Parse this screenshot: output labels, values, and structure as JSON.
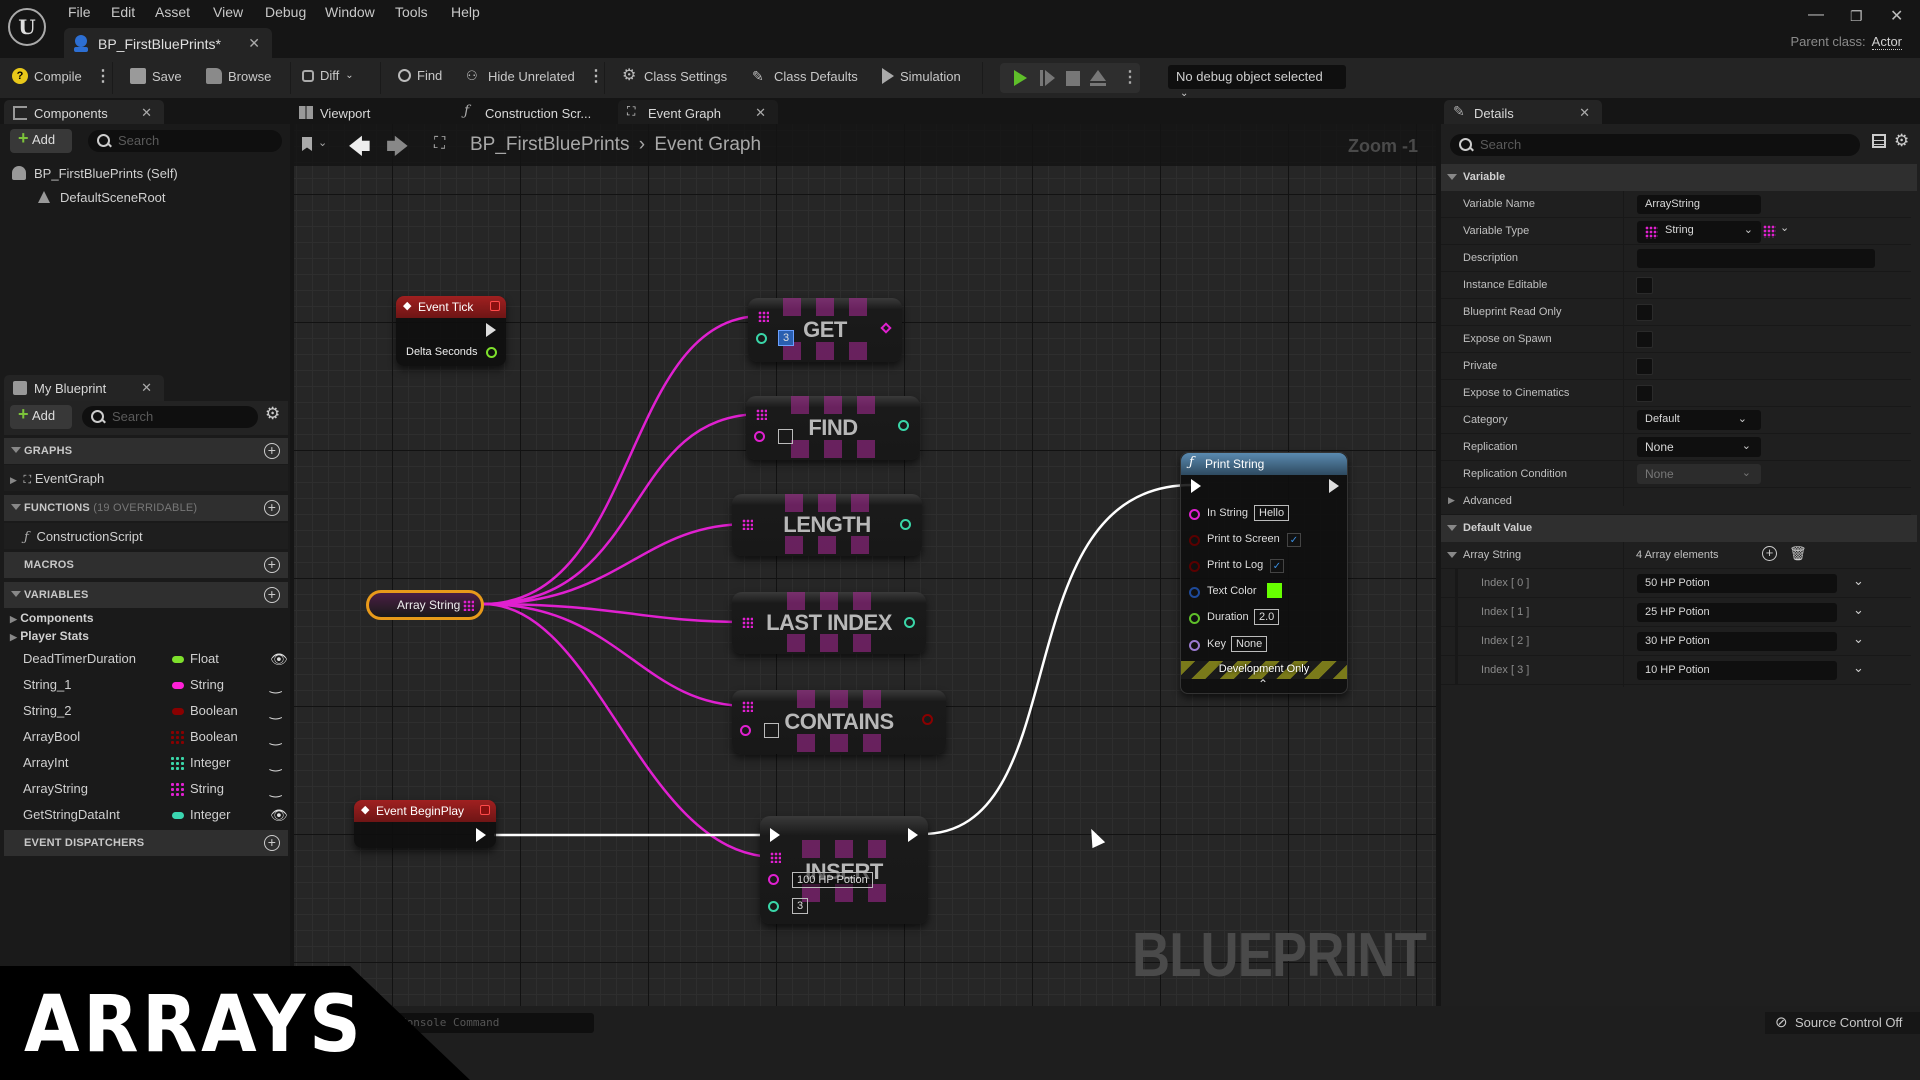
{
  "app": {
    "menu": [
      "File",
      "Edit",
      "Asset",
      "View",
      "Debug",
      "Window",
      "Tools",
      "Help"
    ],
    "document_tab": "BP_FirstBluePrints*",
    "parent_class_label": "Parent class:",
    "parent_class_value": "Actor"
  },
  "toolbar": {
    "compile": "Compile",
    "save": "Save",
    "browse": "Browse",
    "diff": "Diff",
    "find": "Find",
    "hide_unrelated": "Hide Unrelated",
    "class_settings": "Class Settings",
    "class_defaults": "Class Defaults",
    "simulation": "Simulation",
    "debug_object": "No debug object selected"
  },
  "components_panel": {
    "title": "Components",
    "add": "Add",
    "search_placeholder": "Search",
    "tree": [
      "BP_FirstBluePrints (Self)",
      "DefaultSceneRoot"
    ]
  },
  "my_blueprint": {
    "title": "My Blueprint",
    "add": "Add",
    "search_placeholder": "Search",
    "sections": {
      "graphs": "GRAPHS",
      "functions": "FUNCTIONS",
      "functions_sub": "(19 OVERRIDABLE)",
      "macros": "MACROS",
      "variables": "VARIABLES",
      "event_dispatchers": "EVENT DISPATCHERS"
    },
    "graph_items": [
      "EventGraph"
    ],
    "function_items": [
      "ConstructionScript"
    ],
    "variable_categories": [
      "Components",
      "Player Stats"
    ],
    "variables": [
      {
        "name": "DeadTimerDuration",
        "type": "Float",
        "color": "#7ee02c",
        "array": false,
        "visible": true
      },
      {
        "name": "String_1",
        "type": "String",
        "color": "#ff20d8",
        "array": false,
        "visible": false
      },
      {
        "name": "String_2",
        "type": "Boolean",
        "color": "#8a0000",
        "array": false,
        "visible": false
      },
      {
        "name": "ArrayBool",
        "type": "Boolean",
        "color": "#8a0000",
        "array": true,
        "visible": false
      },
      {
        "name": "ArrayInt",
        "type": "Integer",
        "color": "#3ad6a8",
        "array": true,
        "visible": false
      },
      {
        "name": "ArrayString",
        "type": "String",
        "color": "#e020d0",
        "array": true,
        "visible": false
      },
      {
        "name": "GetStringDataInt",
        "type": "Integer",
        "color": "#3ad6b0",
        "array": false,
        "visible": true
      }
    ]
  },
  "editor_tabs": [
    "Viewport",
    "Construction Scr...",
    "Event Graph"
  ],
  "graph": {
    "breadcrumb_root": "BP_FirstBluePrints",
    "breadcrumb_leaf": "Event Graph",
    "zoom": "Zoom -1",
    "watermark": "BLUEPRINT",
    "nodes": {
      "event_tick": {
        "title": "Event Tick",
        "pin": "Delta Seconds"
      },
      "event_begin_play": {
        "title": "Event BeginPlay"
      },
      "array_var": {
        "label": "Array String"
      },
      "get": {
        "label": "GET",
        "index": "3"
      },
      "find": {
        "label": "FIND"
      },
      "length": {
        "label": "LENGTH"
      },
      "last_index": {
        "label": "LAST INDEX"
      },
      "contains": {
        "label": "CONTAINS"
      },
      "insert": {
        "label": "INSERT",
        "item": "100 HP Potion",
        "index": "3"
      },
      "print_string": {
        "title": "Print String",
        "in_string_label": "In String",
        "in_string": "Hello",
        "print_to_screen": "Print to Screen",
        "print_to_log": "Print to Log",
        "text_color": "Text Color",
        "text_color_value": "#66ff00",
        "duration_label": "Duration",
        "duration": "2.0",
        "key_label": "Key",
        "key": "None",
        "footer": "Development Only"
      }
    }
  },
  "details": {
    "title": "Details",
    "search_placeholder": "Search",
    "section_variable": "Variable",
    "variable_name_label": "Variable Name",
    "variable_name": "ArrayString",
    "variable_type_label": "Variable Type",
    "variable_type": "String",
    "description_label": "Description",
    "checkboxes": [
      "Instance Editable",
      "Blueprint Read Only",
      "Expose on Spawn",
      "Private",
      "Expose to Cinematics"
    ],
    "category_label": "Category",
    "category": "Default",
    "replication_label": "Replication",
    "replication": "None",
    "replication_condition_label": "Replication Condition",
    "replication_condition": "None",
    "advanced": "Advanced",
    "section_default": "Default Value",
    "array_label": "Array String",
    "array_count": "4 Array elements",
    "elements": [
      {
        "index": "Index [ 0 ]",
        "value": "50 HP Potion"
      },
      {
        "index": "Index [ 1 ]",
        "value": "25 HP Potion"
      },
      {
        "index": "Index [ 2 ]",
        "value": "30 HP Potion"
      },
      {
        "index": "Index [ 3 ]",
        "value": "10 HP Potion"
      }
    ]
  },
  "bottom": {
    "console_placeholder": "Console Command",
    "source_control": "Source Control Off"
  },
  "overlay": {
    "title": "ARRAYS"
  }
}
